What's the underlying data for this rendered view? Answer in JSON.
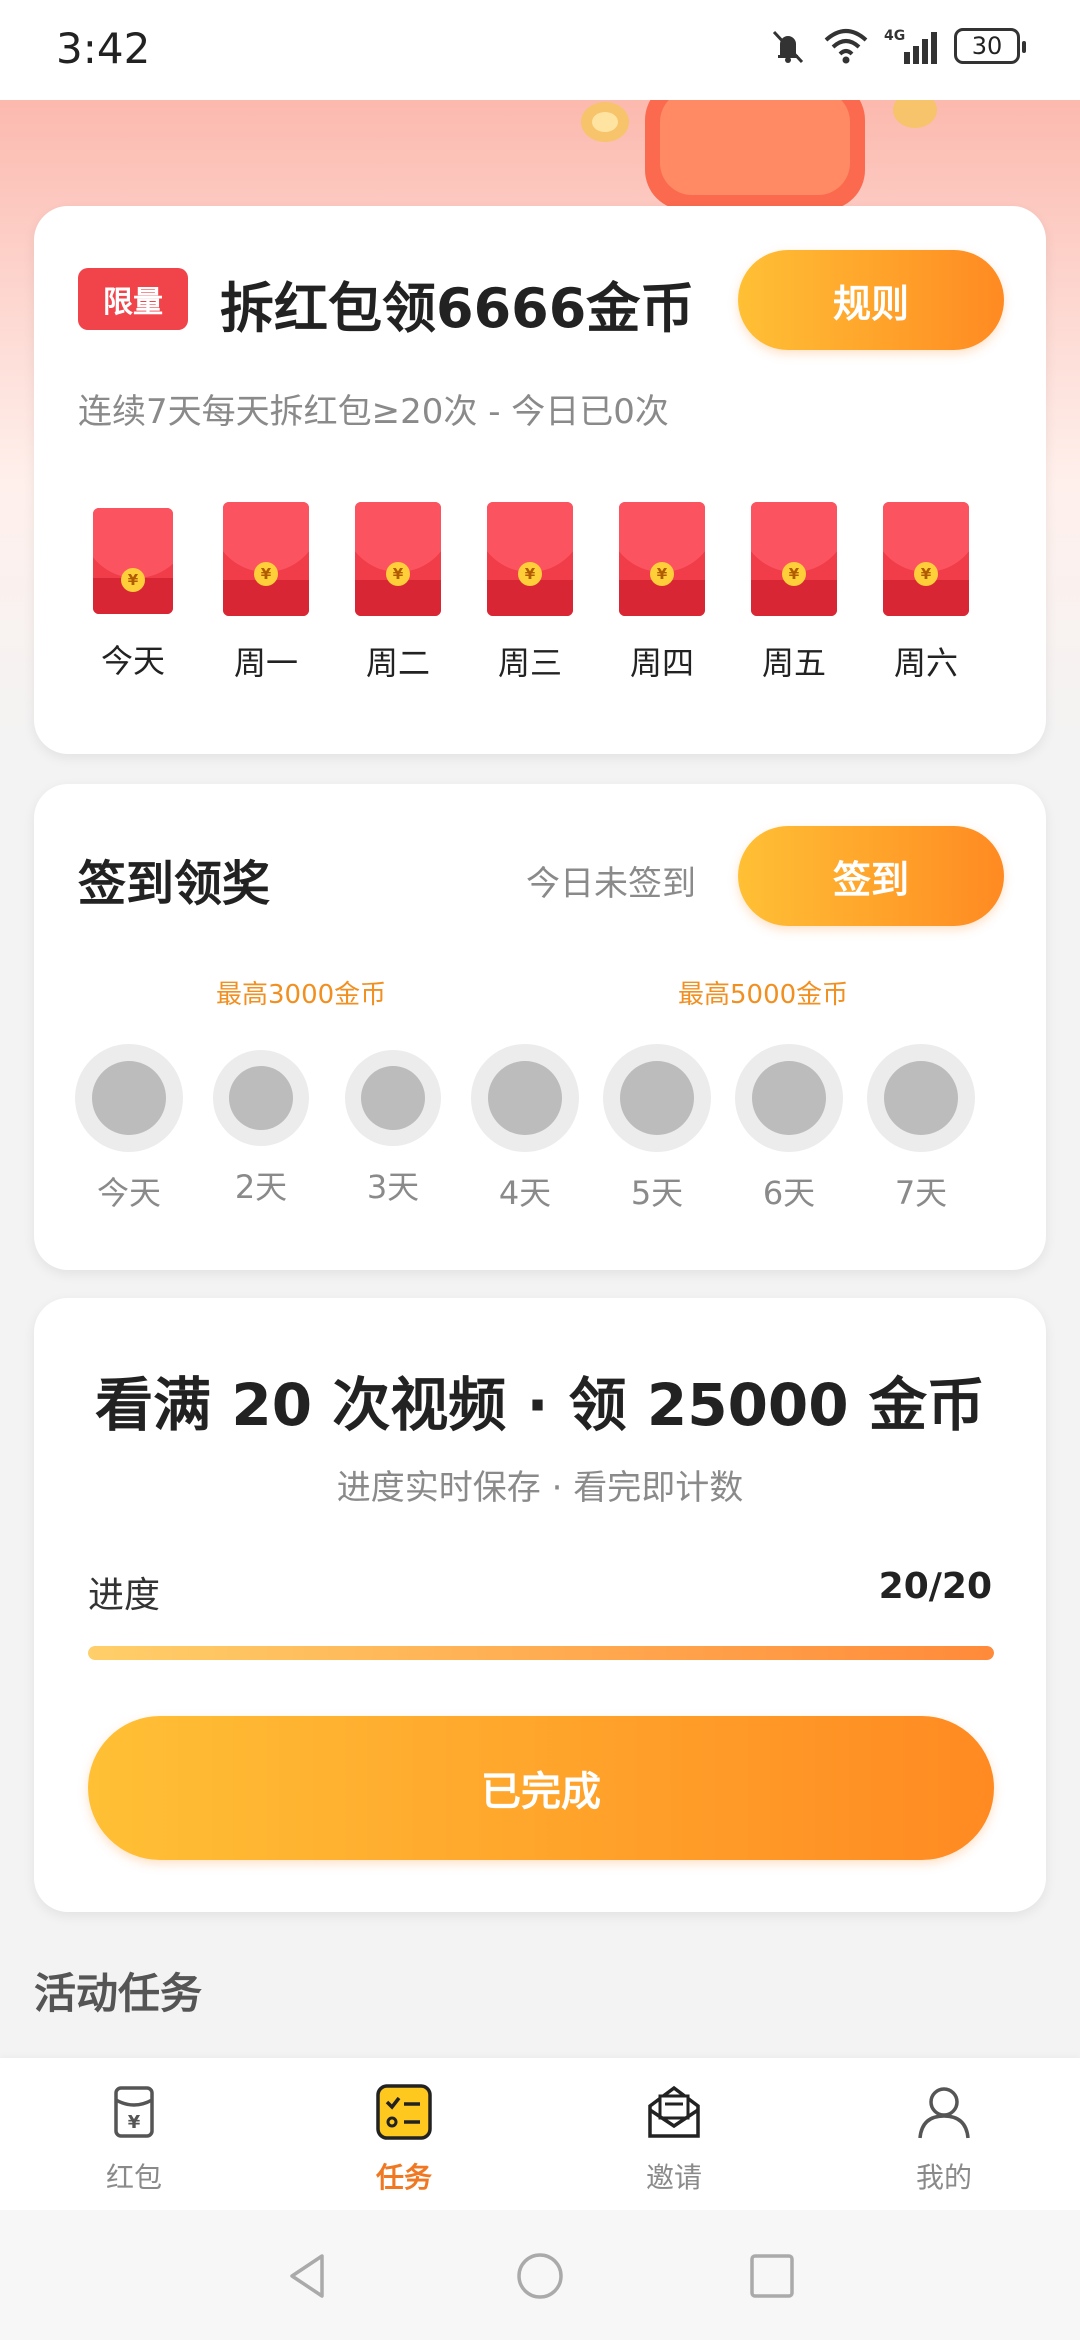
{
  "status_bar": {
    "time": "3:42",
    "battery": "30",
    "network": "4G"
  },
  "packet_card": {
    "tag": "限量",
    "title": "拆红包领6666金币",
    "rules_button": "规则",
    "subtitle": "连续7天每天拆红包≥20次 - 今日已0次",
    "days": [
      "今天",
      "周一",
      "周二",
      "周三",
      "周四",
      "周五",
      "周六"
    ]
  },
  "checkin_card": {
    "title": "签到领奖",
    "status": "今日未签到",
    "button": "签到",
    "max_label_1": "最高3000金币",
    "max_label_2": "最高5000金币",
    "days": [
      "今天",
      "2天",
      "3天",
      "4天",
      "5天",
      "6天",
      "7天"
    ]
  },
  "video_card": {
    "title": "看满 20 次视频 · 领 25000 金币",
    "subtitle": "进度实时保存 · 看完即计数",
    "progress_label": "进度",
    "progress_value": "20/20",
    "progress_fraction": 1.0,
    "button": "已完成"
  },
  "section_title": "活动任务",
  "bottom_nav": {
    "items": [
      {
        "label": "红包",
        "icon": "red-packet-icon",
        "active": false
      },
      {
        "label": "任务",
        "icon": "task-list-icon",
        "active": true
      },
      {
        "label": "邀请",
        "icon": "invite-envelope-icon",
        "active": false
      },
      {
        "label": "我的",
        "icon": "profile-icon",
        "active": false
      }
    ]
  },
  "colors": {
    "accent_orange": "#ff8a22",
    "accent_yellow": "#ffc035",
    "red_packet": "#f13c4a",
    "tag_red": "#f0434a",
    "active_nav": "#f07822",
    "max_label": "#f19021"
  }
}
